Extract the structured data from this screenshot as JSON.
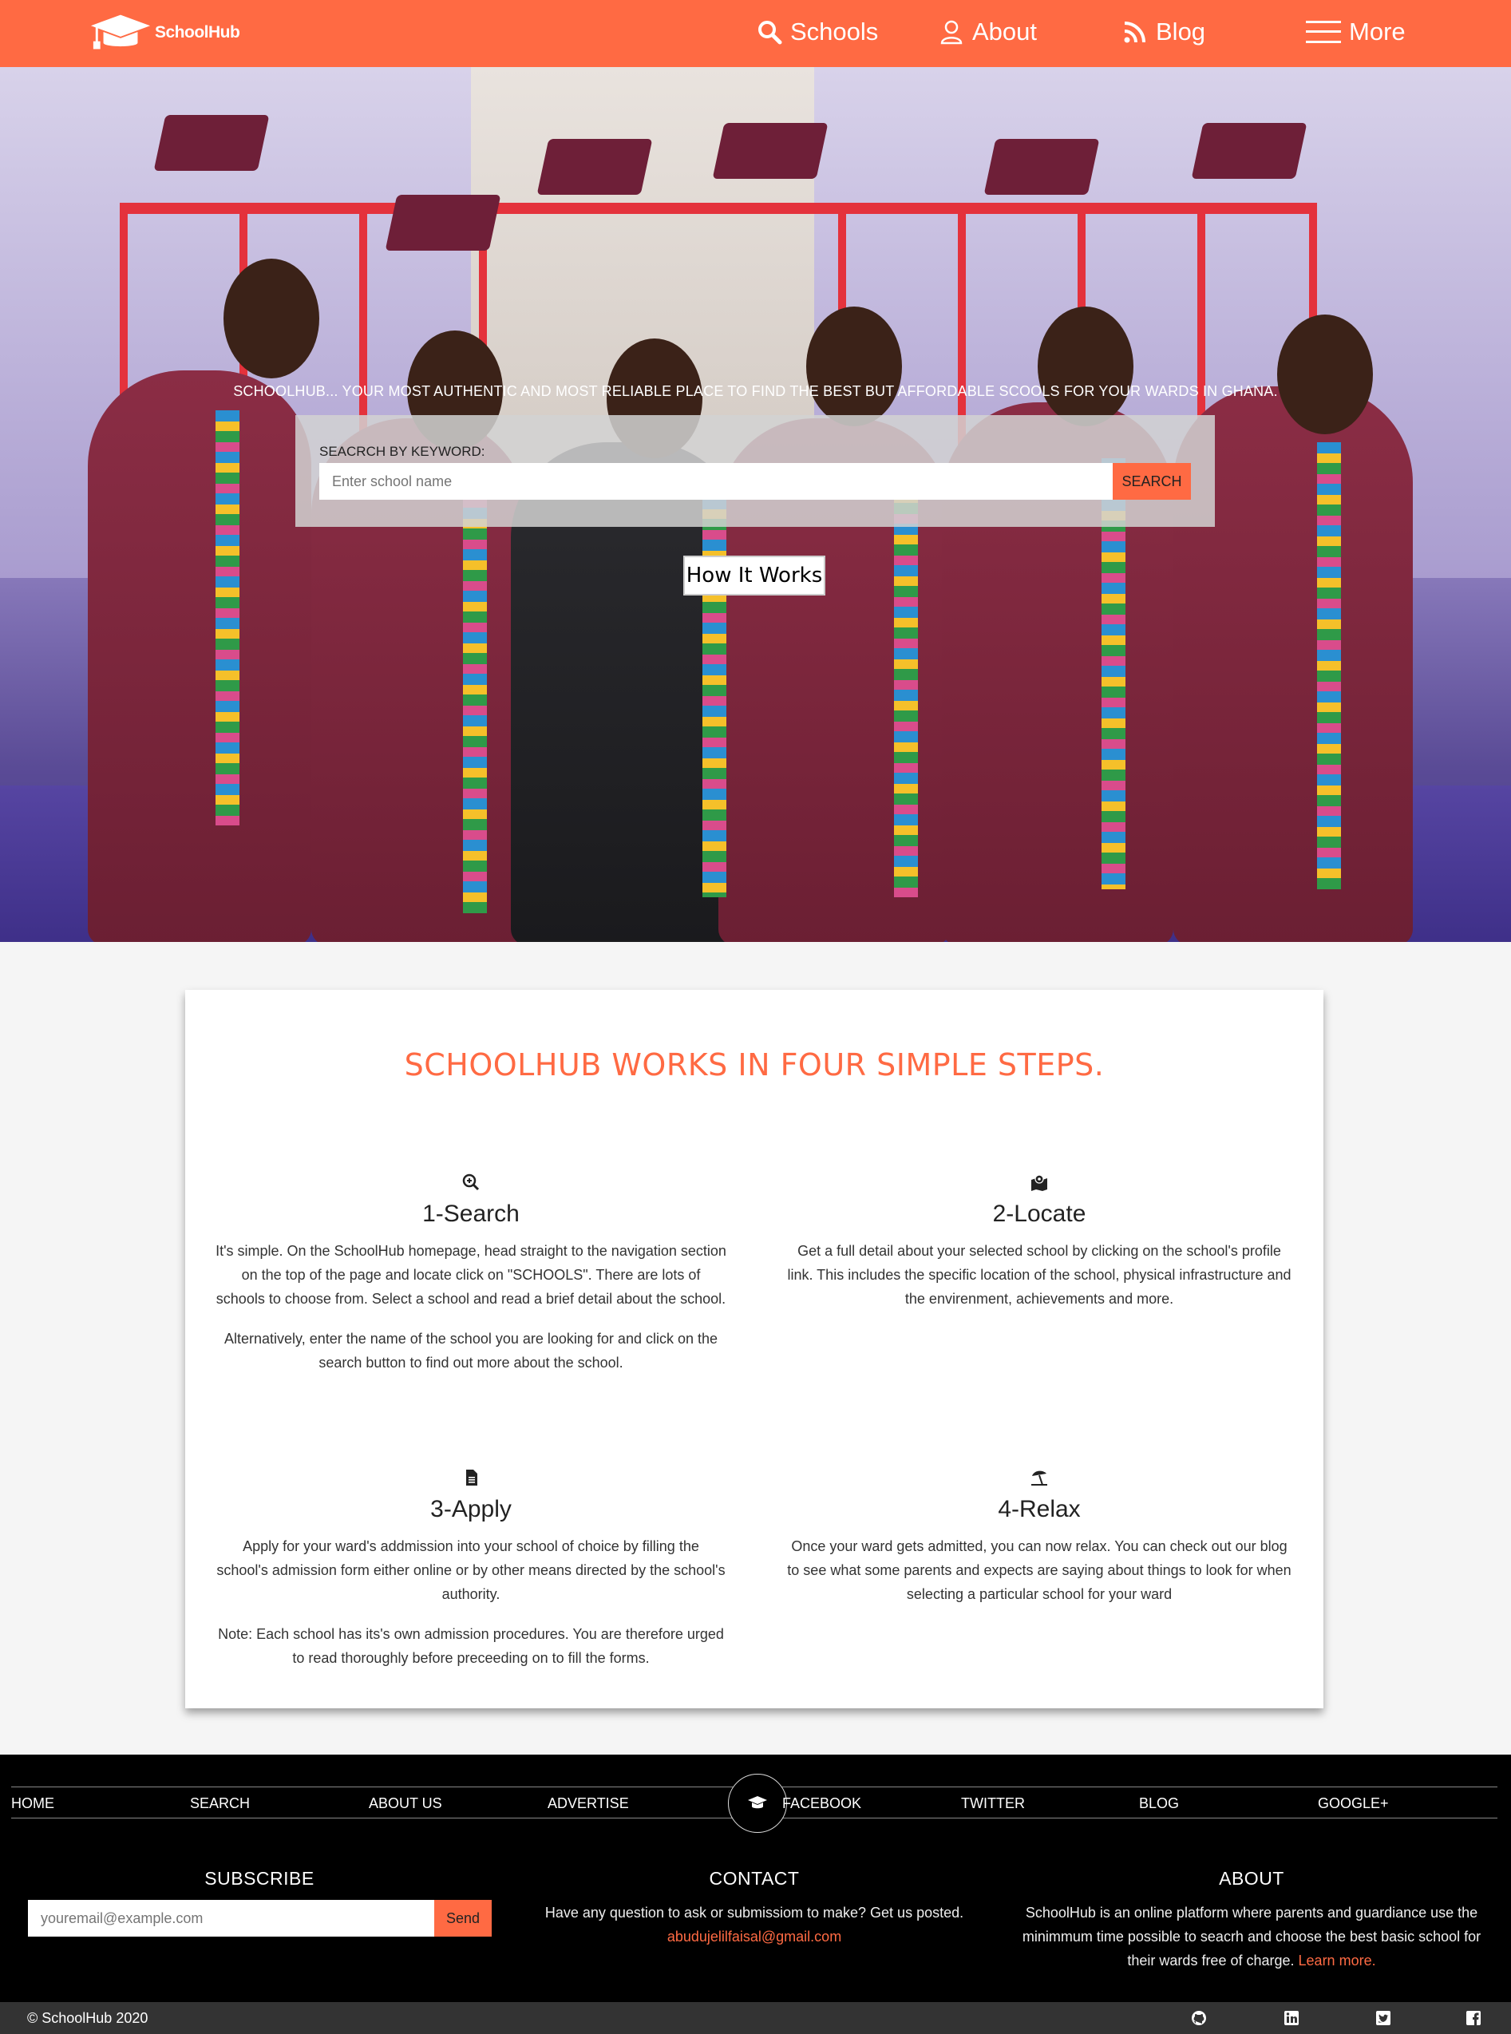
{
  "nav": {
    "brand": "SchoolHub",
    "items": [
      {
        "label": "Schools",
        "icon": "search-icon"
      },
      {
        "label": "About",
        "icon": "user-icon"
      },
      {
        "label": "Blog",
        "icon": "rss-icon"
      },
      {
        "label": "More",
        "icon": "hamburger-menu-icon"
      }
    ]
  },
  "hero": {
    "tagline": "SCHOOLHUB... YOUR MOST AUTHENTIC AND MOST RELIABLE PLACE TO FIND THE BEST BUT AFFORDABLE SCOOLS FOR YOUR WARDS IN GHANA.",
    "search_label": "SEACRCH BY KEYWORD:",
    "search_placeholder": "Enter school name",
    "search_button": "SEARCH",
    "how_button": "How It Works"
  },
  "steps": {
    "title": "SCHOOLHUB WORKS IN FOUR SIMPLE STEPS.",
    "items": [
      {
        "title": "1-Search",
        "icon": "search-plus-icon",
        "paragraphs": [
          "It's simple. On the SchoolHub homepage, head straight to the navigation section on the top of the page and locate click on \"SCHOOLS\". There are lots of schools to choose from. Select a school and read a brief detail about the school.",
          "Alternatively, enter the name of the school you are looking for and click on the search button to find out more about the school."
        ]
      },
      {
        "title": "2-Locate",
        "icon": "map-marked-icon",
        "paragraphs": [
          "Get a full detail about your selected school by clicking on the school's profile link. This includes the specific location of the school, physical infrastructure and the envirenment, achievements and more.",
          ""
        ]
      },
      {
        "title": "3-Apply",
        "icon": "file-icon",
        "paragraphs": [
          "Apply for your ward's addmission into your school of choice by filling the school's admission form either online or by other means directed by the school's authority.",
          "Note: Each school has its's own admission procedures. You are therefore urged to read thoroughly before preceeding on to fill the forms."
        ]
      },
      {
        "title": "4-Relax",
        "icon": "umbrella-beach-icon",
        "paragraphs": [
          "Once your ward gets admitted, you can now relax. You can check out our blog to see what some parents and expects are saying about things to look for when selecting a particular school for your ward",
          ""
        ]
      }
    ]
  },
  "footer": {
    "nav": [
      "HOME",
      "SEARCH",
      "ABOUT US",
      "ADVERTISE",
      "FACEBOOK",
      "TWITTER",
      "BLOG",
      "GOOGLE+"
    ],
    "subscribe": {
      "title": "SUBSCRIBE",
      "placeholder": "youremail@example.com",
      "button": "Send"
    },
    "contact": {
      "title": "CONTACT",
      "text": "Have any question to ask or submissiom to make? Get us posted.",
      "email": "abudujelilfaisal@gmail.com"
    },
    "about": {
      "title": "ABOUT",
      "text": "SchoolHub is an online platform where parents and guardiance use the minimmum time possible to seacrh and choose the best basic school for their wards free of charge.",
      "link": "Learn more."
    },
    "copyright": "© SchoolHub 2020",
    "social": [
      "github-icon",
      "linkedin-icon",
      "twitter-icon",
      "facebook-icon"
    ]
  },
  "colors": {
    "accent": "#ff6a43",
    "footer_bg": "#000000",
    "bottom_bar": "#333333"
  }
}
